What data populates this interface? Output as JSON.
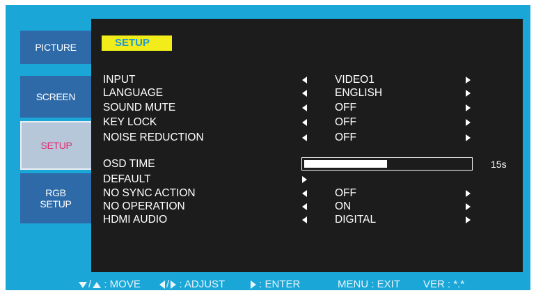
{
  "tabs": [
    {
      "label": "PICTURE",
      "active": false
    },
    {
      "label": "SCREEN",
      "active": false
    },
    {
      "label": "SETUP",
      "active": true
    },
    {
      "label": "RGB\nSETUP",
      "active": false
    }
  ],
  "panel_title": "SETUP",
  "rows": [
    {
      "label": "INPUT",
      "value": "VIDEO1"
    },
    {
      "label": "LANGUAGE",
      "value": "ENGLISH"
    },
    {
      "label": "SOUND MUTE",
      "value": "OFF"
    },
    {
      "label": "KEY LOCK",
      "value": "OFF"
    },
    {
      "label": "NOISE REDUCTION",
      "value": "OFF"
    },
    {
      "label": "OSD TIME",
      "value": "15s",
      "level": 0.5
    },
    {
      "label": "DEFAULT",
      "value": ""
    },
    {
      "label": "NO SYNC ACTION",
      "value": "OFF"
    },
    {
      "label": "NO OPERATION",
      "value": "ON"
    },
    {
      "label": "HDMI AUDIO",
      "value": "DIGITAL"
    }
  ],
  "footer": {
    "move_label": ": MOVE",
    "adjust_label": ": ADJUST",
    "enter_label": ": ENTER",
    "exit_label": "MENU : EXIT",
    "version_label": "VER : *.*"
  },
  "colors": {
    "frame": "#1aa7d8",
    "panel": "#1c1c1c",
    "tab": "#2e6aa8",
    "tab_active": "#b7c7da",
    "tab_active_text": "#e02c6f",
    "title_bg": "#f2ec1a",
    "title_text": "#1e9ad6"
  }
}
